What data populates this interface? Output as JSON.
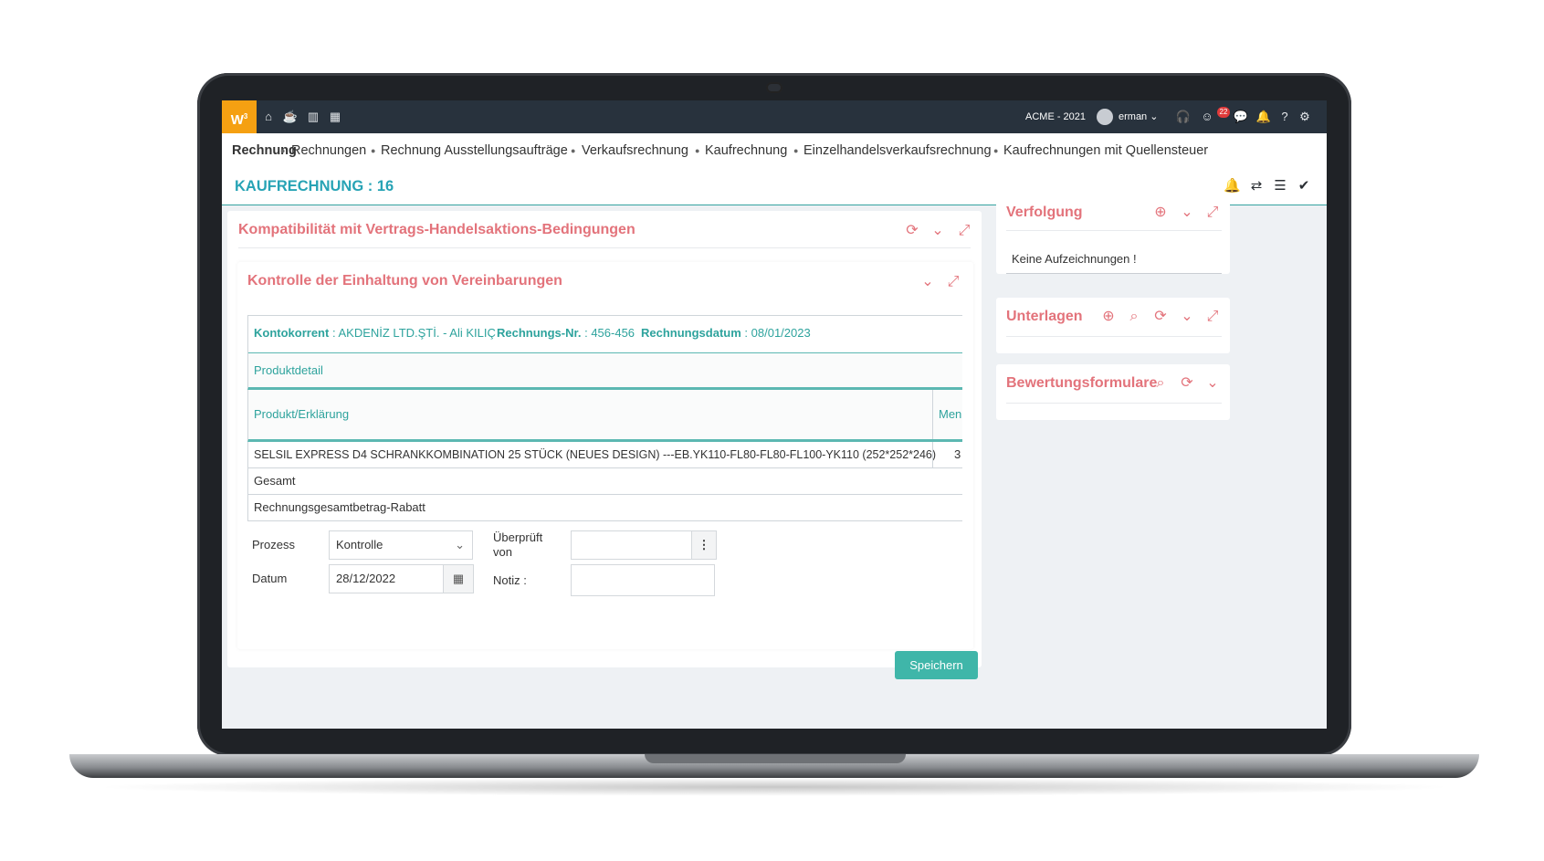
{
  "topbar": {
    "logo": "W",
    "logo_sup": "3",
    "company": "ACME - 2021",
    "user": "erman",
    "notification_count": "22",
    "icons": [
      "home-icon",
      "coffee-icon",
      "chart-icon",
      "calendar-icon",
      "headset-icon",
      "smiley-icon",
      "chat-icon",
      "bell-icon",
      "help-icon",
      "gear-icon"
    ]
  },
  "breadcrumb": {
    "active": "Rechnung",
    "items": [
      "Rechnungen",
      "Rechnung Ausstellungsaufträge",
      "Verkaufsrechnung",
      "Kaufrechnung",
      "Einzelhandelsverkaufsrechnung",
      "Kaufrechnungen mit Quellensteuer"
    ]
  },
  "page": {
    "title": "KAUFRECHNUNG : 16"
  },
  "main_panel": {
    "title": "Kompatibilität mit Vertrags-Handelsaktions-Bedingungen",
    "inner": {
      "title": "Kontrolle der Einhaltung von Vereinbarungen",
      "info": {
        "kontokorrent_label": "Kontokorrent",
        "kontokorrent_value": ": AKDENİZ LTD.ŞTİ. - Ali KILIÇ",
        "rechnungsnr_label": "Rechnungs-Nr.",
        "rechnungsnr_value": ": 456-456",
        "rechnungsdatum_label": "Rechnungsdatum",
        "rechnungsdatum_value": ": 08/01/2023"
      },
      "produktdetail": "Produktdetail",
      "columns": [
        "Produkt/Erklärung",
        "Men"
      ],
      "row": {
        "product": "SELSIL EXPRESS D4 SCHRANKKOMBINATION 25 STÜCK (NEUES DESIGN) ---EB.YK110-FL80-FL80-FL100-YK110 (252*252*246)",
        "qty": "3"
      },
      "gesamt": "Gesamt",
      "rabatt": "Rechnungsgesamtbetrag-Rabatt",
      "form": {
        "prozess_label": "Prozess",
        "prozess_value": "Kontrolle",
        "datum_label": "Datum",
        "datum_value": "28/12/2022",
        "ueberprueft_label_1": "Überprüft",
        "ueberprueft_label_2": "von",
        "notiz_label": "Notiz :",
        "save": "Speichern"
      }
    }
  },
  "side": {
    "verfolgung": {
      "title": "Verfolgung",
      "empty": "Keine Aufzeichnungen !"
    },
    "unterlagen": {
      "title": "Unterlagen"
    },
    "bewertung": {
      "title": "Bewertungsformulare"
    }
  }
}
